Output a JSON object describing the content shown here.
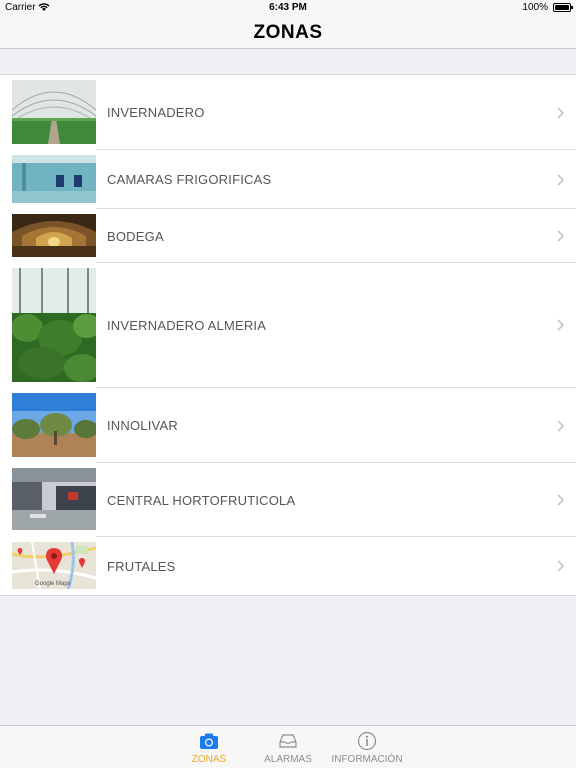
{
  "status_bar": {
    "carrier": "Carrier",
    "time": "6:43 PM",
    "battery": "100%"
  },
  "nav": {
    "title": "ZONAS"
  },
  "zones": [
    {
      "label": "INVERNADERO"
    },
    {
      "label": "CAMARAS FRIGORIFICAS"
    },
    {
      "label": "BODEGA"
    },
    {
      "label": "INVERNADERO ALMERIA"
    },
    {
      "label": "INNOLIVAR"
    },
    {
      "label": "CENTRAL HORTOFRUTICOLA"
    },
    {
      "label": "FRUTALES"
    }
  ],
  "map_thumb": {
    "attribution": "Google Maps"
  },
  "tabs": [
    {
      "label": "ZONAS",
      "icon": "camera-icon",
      "active": true
    },
    {
      "label": "ALARMAS",
      "icon": "inbox-icon",
      "active": false
    },
    {
      "label": "INFORMACIÓN",
      "icon": "info-icon",
      "active": false
    }
  ],
  "colors": {
    "active_tab": "#f5a623",
    "accent_blue": "#1b7cf0",
    "background": "#efeff4"
  }
}
